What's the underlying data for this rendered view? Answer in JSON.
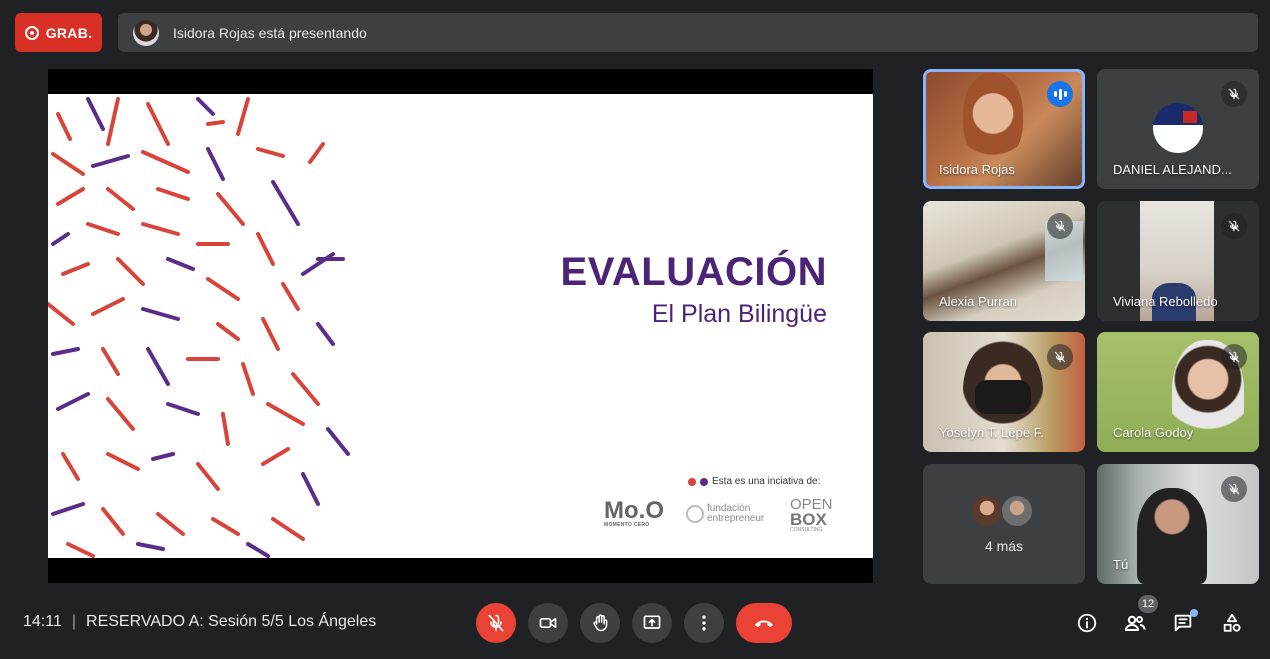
{
  "recording": {
    "label": "GRAB.",
    "color": "#d93025"
  },
  "presenter_bar": {
    "text": "Isidora Rojas está presentando"
  },
  "slide": {
    "title": "EVALUACIÓN",
    "subtitle": "El Plan Bilingüe",
    "initiative_text": "Esta es una inciativa de:",
    "logos": {
      "moo_main": "Mo.O",
      "moo_sub": "MOMENTO CERO",
      "fundacion_line1": "fundación",
      "fundacion_line2": "entrepreneur",
      "openbox_line1": "OPEN",
      "openbox_line2": "BOX",
      "openbox_line3": "CONSULTING"
    },
    "accent_colors": {
      "purple": "#4b2377",
      "red": "#d9443a"
    }
  },
  "participants": [
    {
      "name": "Isidora Rojas",
      "muted": false,
      "speaking": true
    },
    {
      "name": "DANIEL ALEJAND...",
      "muted": true
    },
    {
      "name": "Alexia Purran",
      "muted": true
    },
    {
      "name": "Viviana Rebolledo",
      "muted": true
    },
    {
      "name": "Yoselyn T. Lepe F.",
      "muted": true
    },
    {
      "name": "Carola Godoy",
      "muted": true
    },
    {
      "more_label": "4 más"
    },
    {
      "name": "Tú",
      "muted": true
    }
  ],
  "bottom_bar": {
    "time": "14:11",
    "separator": "|",
    "meeting_title": "RESERVADO A: Sesión 5/5 Los Ángeles",
    "people_count": "12",
    "controls": [
      "mic-off",
      "camera",
      "raise-hand",
      "present",
      "more-options",
      "end-call"
    ],
    "right_controls": [
      "meeting-details",
      "people",
      "chat",
      "activities"
    ]
  }
}
